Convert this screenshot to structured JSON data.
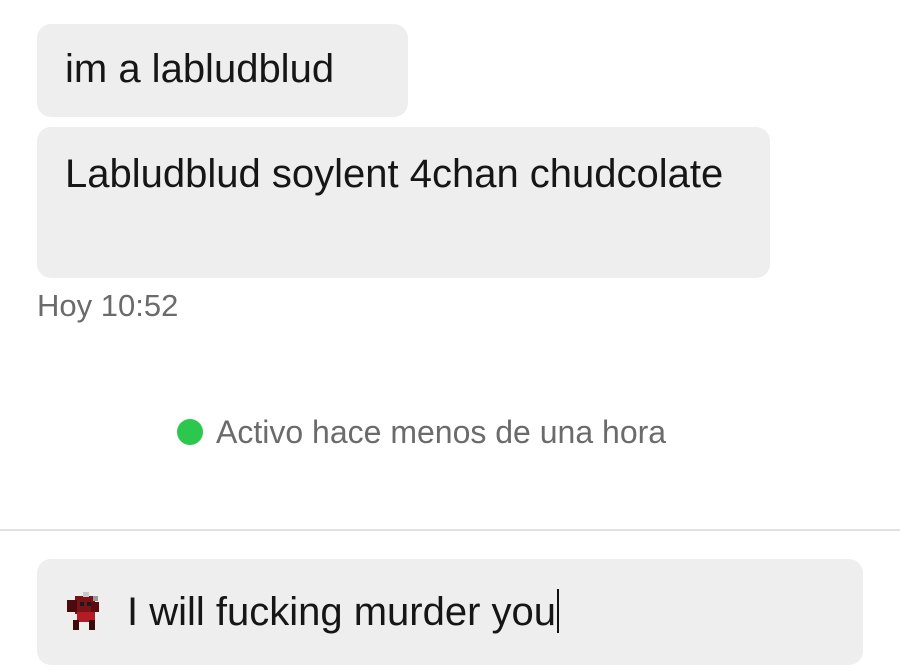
{
  "messages": [
    {
      "text": "im a labludblud"
    },
    {
      "text": "Labludblud soylent 4chan chudcolate"
    }
  ],
  "timestamp": "Hoy 10:52",
  "status": {
    "text": "Activo hace menos de una hora",
    "dot_color": "#2cc84d"
  },
  "composer": {
    "avatar_icon": "red-creature-avatar-icon",
    "value": "I will fucking murder you"
  }
}
